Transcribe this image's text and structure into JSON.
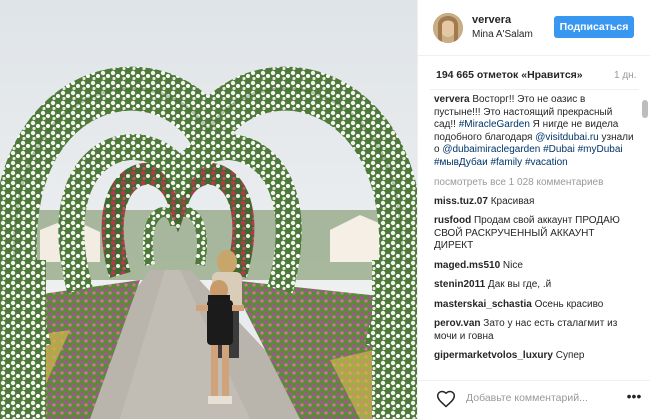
{
  "header": {
    "username": "ververa",
    "location": "Mina A'Salam",
    "follow_label": "Подписаться"
  },
  "stats": {
    "likes": "194 665 отметок «Нравится»",
    "time_ago": "1 дн."
  },
  "caption": {
    "user": "ververa",
    "segments": [
      {
        "t": "Восторг!!  Это не оазис в пустыне!!! Это настоящий прекрасный сад!! ",
        "type": "text"
      },
      {
        "t": "#MiracleGarden",
        "type": "tag"
      },
      {
        "t": "  Я нигде не видела подобного  благодаря ",
        "type": "text"
      },
      {
        "t": "@visitdubai.ru",
        "type": "tag"
      },
      {
        "t": " узнали о ",
        "type": "text"
      },
      {
        "t": "@dubaimiraclegarden",
        "type": "tag"
      },
      {
        "t": " ",
        "type": "text"
      },
      {
        "t": "#Dubai",
        "type": "tag"
      },
      {
        "t": " ",
        "type": "text"
      },
      {
        "t": "#myDubai",
        "type": "tag"
      },
      {
        "t": " ",
        "type": "text"
      },
      {
        "t": "#мывДубаи",
        "type": "tag"
      },
      {
        "t": " ",
        "type": "text"
      },
      {
        "t": "#family",
        "type": "tag"
      },
      {
        "t": " ",
        "type": "text"
      },
      {
        "t": "#vacation",
        "type": "tag"
      }
    ]
  },
  "view_all": "посмотреть все 1 028 комментариев",
  "comments": [
    {
      "user": "miss.tuz.07",
      "text": "Красивая"
    },
    {
      "user": "rusfood",
      "text": "Продам свой аккаунт  ПРОДАЮ СВОЙ РАСКРУЧЕННЫЙ АККАУНТ  ДИРЕКТ"
    },
    {
      "user": "maged.ms510",
      "text": "Nice"
    },
    {
      "user": "stenin2011",
      "text": "Дак вы где, .й"
    },
    {
      "user": "masterskai_schastia",
      "text": "Осень красиво"
    },
    {
      "user": "perov.van",
      "text": "Зато у нас есть сталагмит из мочи и говна"
    },
    {
      "user": "gipermаrketvolos_luxury",
      "text": "Супер"
    }
  ],
  "footer": {
    "placeholder": "Добавьте комментарий..."
  },
  "icons": {
    "avatar": "user-avatar",
    "heart": "heart-icon",
    "more": "more-options-icon"
  },
  "colors": {
    "follow_button": "#3897f0",
    "hashtag": "#003569"
  }
}
